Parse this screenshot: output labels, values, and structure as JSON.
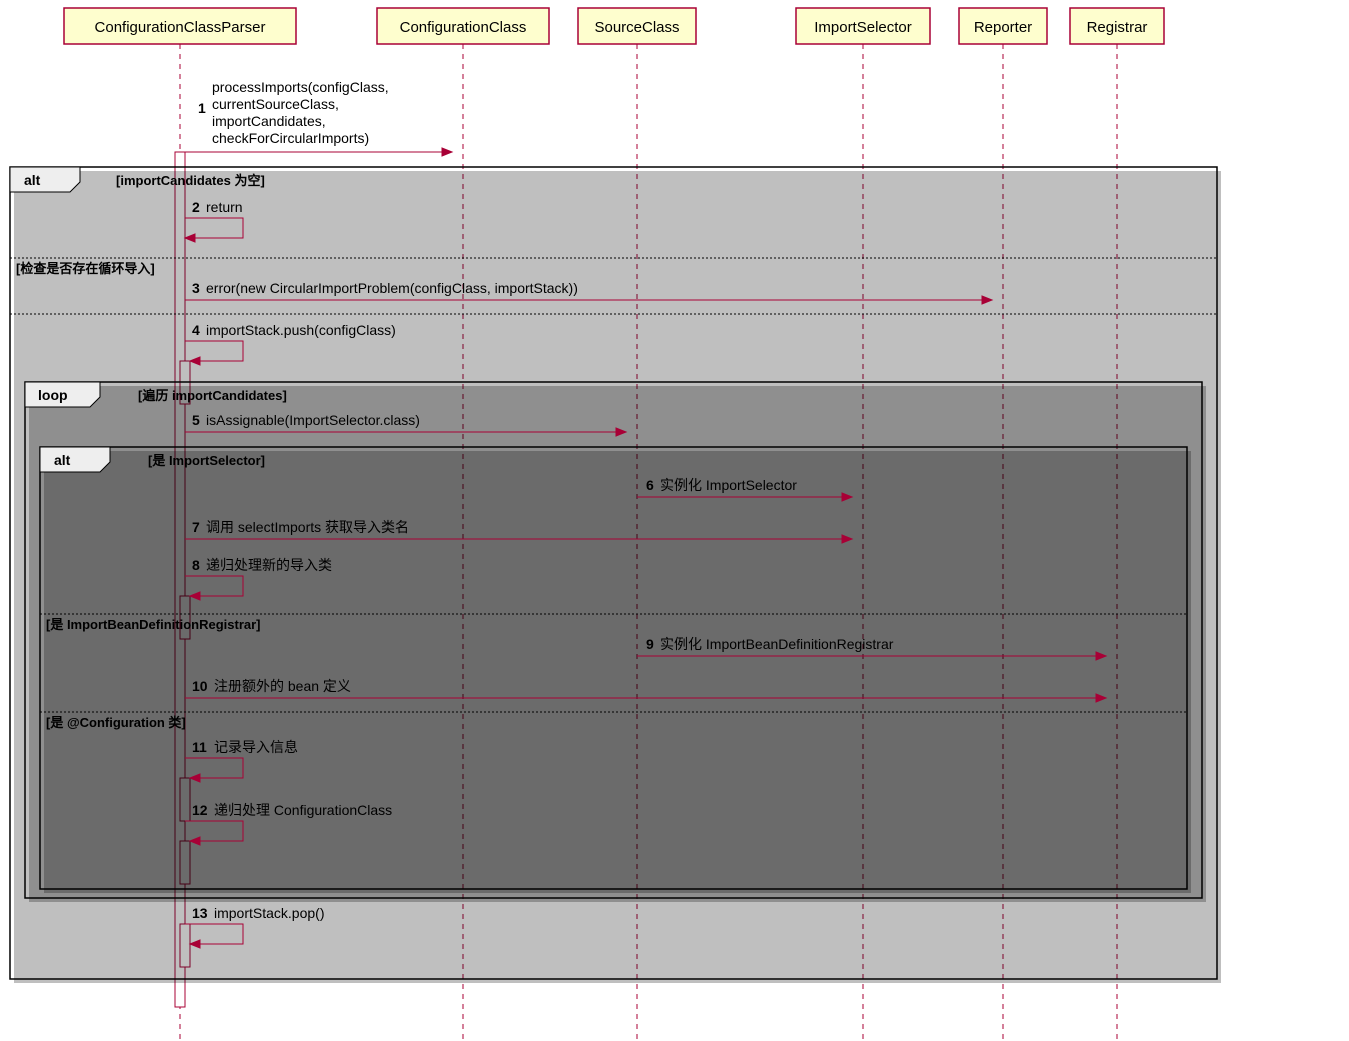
{
  "participants": {
    "p1": "ConfigurationClassParser",
    "p2": "ConfigurationClass",
    "p3": "SourceClass",
    "p4": "ImportSelector",
    "p5": "Reporter",
    "p6": "Registrar"
  },
  "messages": {
    "m1_num": "1",
    "m1_l1": "processImports(configClass,",
    "m1_l2": "currentSourceClass,",
    "m1_l3": "importCandidates,",
    "m1_l4": "checkForCircularImports)",
    "m2_num": "2",
    "m2": "return",
    "m3_num": "3",
    "m3": "error(new CircularImportProblem(configClass, importStack))",
    "m4_num": "4",
    "m4": "importStack.push(configClass)",
    "m5_num": "5",
    "m5": "isAssignable(ImportSelector.class)",
    "m6_num": "6",
    "m6": "实例化 ImportSelector",
    "m7_num": "7",
    "m7": "调用 selectImports 获取导入类名",
    "m8_num": "8",
    "m8": "递归处理新的导入类",
    "m9_num": "9",
    "m9": "实例化 ImportBeanDefinitionRegistrar",
    "m10_num": "10",
    "m10": "注册额外的 bean 定义",
    "m11_num": "11",
    "m11": "记录导入信息",
    "m12_num": "12",
    "m12": "递归处理 ConfigurationClass",
    "m13_num": "13",
    "m13": "importStack.pop()"
  },
  "frames": {
    "alt1_label": "alt",
    "alt1_guard1": "[importCandidates 为空]",
    "alt1_guard2": "[检查是否存在循环导入]",
    "loop_label": "loop",
    "loop_guard": "[遍历 importCandidates]",
    "alt2_label": "alt",
    "alt2_guard1": "[是 ImportSelector]",
    "alt2_guard2": "[是 ImportBeanDefinitionRegistrar]",
    "alt2_guard3": "[是 @Configuration 类]"
  }
}
